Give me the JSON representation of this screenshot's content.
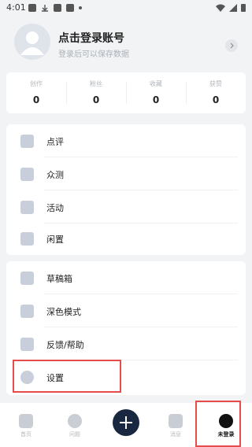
{
  "status_bar": {
    "time": "4:01"
  },
  "profile": {
    "title": "点击登录账号",
    "subtitle": "登录后可以保存数据"
  },
  "stats": [
    {
      "label": "创作",
      "value": "0"
    },
    {
      "label": "粉丝",
      "value": "0"
    },
    {
      "label": "收藏",
      "value": "0"
    },
    {
      "label": "获赞",
      "value": "0"
    }
  ],
  "menu_group_1": [
    {
      "label": "点评",
      "icon": "review-icon"
    },
    {
      "label": "众测",
      "icon": "crowd-test-icon"
    },
    {
      "label": "活动",
      "icon": "flag-icon"
    },
    {
      "label": "闲置",
      "icon": "idle-items-icon"
    }
  ],
  "menu_group_2": [
    {
      "label": "草稿箱",
      "icon": "drafts-icon"
    },
    {
      "label": "深色模式",
      "icon": "brush-icon"
    },
    {
      "label": "反馈/帮助",
      "icon": "chat-icon"
    },
    {
      "label": "设置",
      "icon": "gear-icon"
    }
  ],
  "tabs": [
    {
      "label": "首页"
    },
    {
      "label": "问题"
    },
    {
      "label": ""
    },
    {
      "label": "消息"
    },
    {
      "label": "未登录"
    }
  ],
  "colors": {
    "accent_dark": "#1a2740",
    "highlight": "#e74c4c"
  }
}
